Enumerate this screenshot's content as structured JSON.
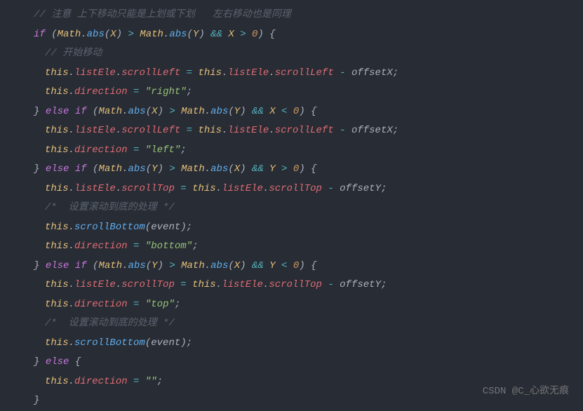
{
  "code": {
    "c1": "// 注意 上下移动只能是上划或下划   左右移动也是同理",
    "c2": "// 开始移动",
    "c3": "/*  设置滚动到底的处理 */",
    "c4": "/*  设置滚动到底的处理 */",
    "kw_if": "if",
    "kw_else": "else",
    "kw_this": "this",
    "Math": "Math",
    "abs": "abs",
    "X": "X",
    "Y": "Y",
    "zero": "0",
    "amp": "&&",
    "gt": ">",
    "lt": "<",
    "eq": "=",
    "listEle": "listEle",
    "scrollLeft": "scrollLeft",
    "scrollTop": "scrollTop",
    "direction": "direction",
    "scrollBottom": "scrollBottom",
    "offsetX": "offsetX",
    "offsetY": "offsetY",
    "event": "event",
    "str_right": "\"right\"",
    "str_left": "\"left\"",
    "str_bottom": "\"bottom\"",
    "str_top": "\"top\"",
    "str_empty": "\"\"",
    "lbrace": "{",
    "rbrace": "}",
    "lparen": "(",
    "rparen": ")",
    "dot": ".",
    "semi": ";",
    "minus": "-"
  },
  "watermark": "CSDN @C_心欲无痕"
}
